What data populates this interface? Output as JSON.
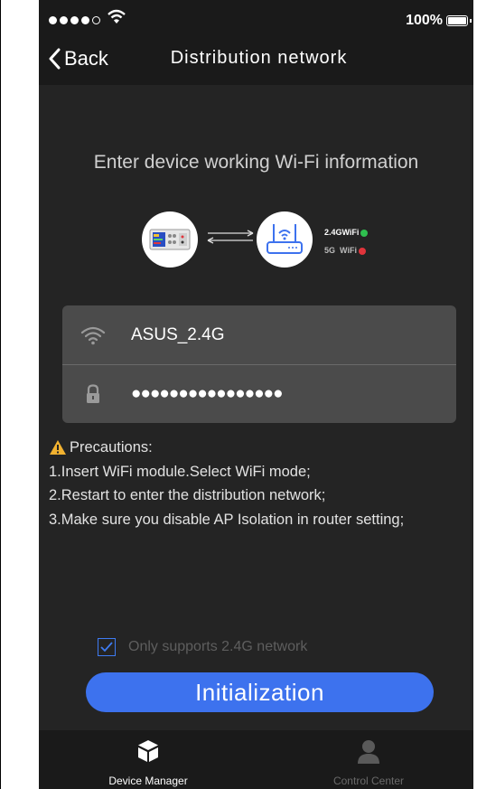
{
  "status_bar": {
    "battery_text": "100%"
  },
  "nav": {
    "back_label": "Back",
    "title": "Distribution network"
  },
  "heading": "Enter device working Wi-Fi information",
  "illustration": {
    "band_24": "2.4GWiFi",
    "band_5_prefix": "5G",
    "band_5_suffix": "WiFi"
  },
  "form": {
    "ssid": "ASUS_2.4G",
    "password_masked": "●●●●●●●●●●●●●●●●"
  },
  "precautions": {
    "title": "Precautions:",
    "items": [
      "1.Insert WiFi module.Select WiFi mode;",
      "2.Restart to enter the distribution network;",
      "3.Make sure you disable AP Isolation in router setting;"
    ]
  },
  "option": {
    "label": "Only supports 2.4G network",
    "checked": true
  },
  "primary_button": "Initialization",
  "tabs": [
    {
      "label": "Device Manager",
      "icon": "cube-icon",
      "active": true
    },
    {
      "label": "Control Center",
      "icon": "person-icon",
      "active": false
    }
  ],
  "colors": {
    "accent": "#3d72ee",
    "background": "#242424",
    "bar": "#1a1a1a",
    "ok": "#2fbf4f",
    "error": "#e0343b"
  }
}
